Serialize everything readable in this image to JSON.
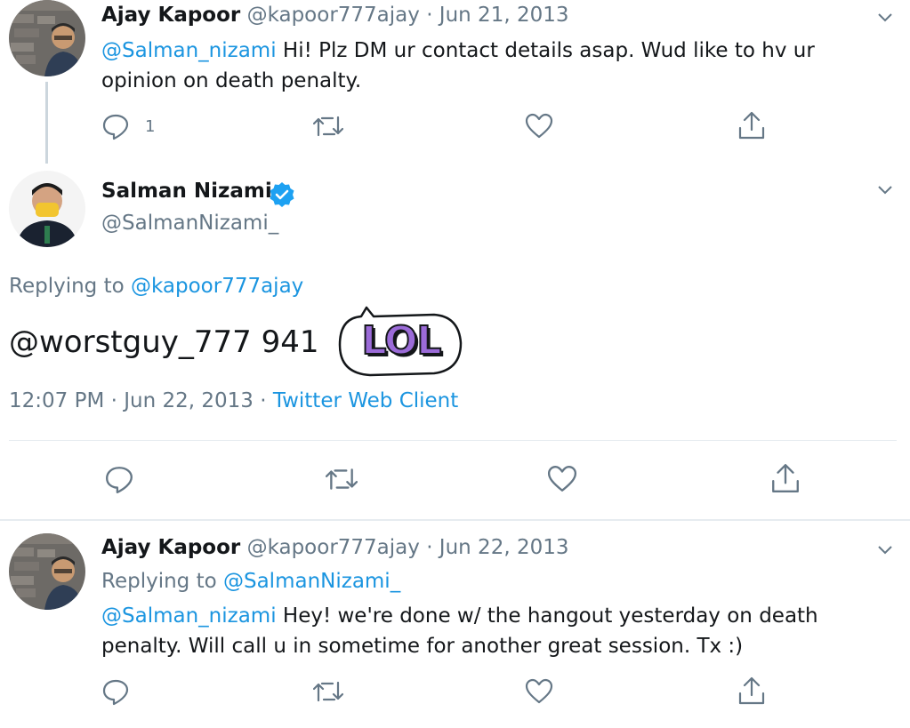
{
  "tweet1": {
    "author_name": "Ajay Kapoor",
    "handle": "@kapoor777ajay",
    "date": "· Jun 21, 2013",
    "mention": "@Salman_nizami",
    "text_line1": " Hi! Plz DM ur contact details asap. Wud like to hv ur",
    "text_line2": "opinion on death penalty.",
    "reply_count": "1"
  },
  "tweet2": {
    "author_name": "Salman Nizami",
    "handle": "@SalmanNizami_",
    "replying_prefix": "Replying to ",
    "replying_handle": "@kapoor777ajay",
    "text": "@worstguy_777 941",
    "sticker_text": "LOL",
    "time": "12:07 PM · Jun 22, 2013 · ",
    "client": "Twitter Web Client"
  },
  "tweet3": {
    "author_name": "Ajay Kapoor",
    "handle": "@kapoor777ajay",
    "date": "· Jun 22, 2013",
    "replying_prefix": "Replying to ",
    "replying_handle": "@SalmanNizami_",
    "mention": "@Salman_nizami",
    "text_line1": " Hey! we're done w/ the hangout yesterday on death",
    "text_line2": "penalty. Will call u in sometime for another great session. Tx :)"
  },
  "icons": {
    "reply": "reply-icon",
    "retweet": "retweet-icon",
    "like": "heart-icon",
    "share": "share-icon",
    "more": "chevron-down-icon",
    "verified": "verified-badge-icon"
  },
  "colors": {
    "link": "#1b95e0",
    "secondary_text": "#657786",
    "thread_line": "#ccd6dd",
    "sticker_fill": "#9b6bd8"
  }
}
